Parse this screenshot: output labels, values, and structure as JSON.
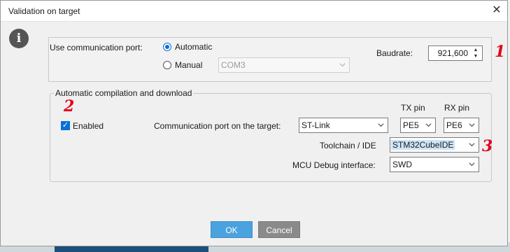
{
  "window": {
    "title": "Validation on target",
    "close": "✕"
  },
  "info_icon": {
    "glyph": "i",
    "name": "info-icon"
  },
  "comm_port": {
    "label": "Use communication port:",
    "automatic_label": "Automatic",
    "manual_label": "Manual",
    "selected": "Automatic",
    "port_value": "COM3",
    "baudrate_label": "Baudrate:",
    "baudrate_value": "921,600"
  },
  "compile_group": {
    "legend": "Automatic compilation and download",
    "enabled_label": "Enabled",
    "enabled_checked": true,
    "tx_header": "TX pin",
    "rx_header": "RX pin",
    "comm_port_label": "Communication port on the target:",
    "comm_port_value": "ST-Link",
    "tx_value": "PE5",
    "rx_value": "PE6",
    "toolchain_label": "Toolchain / IDE",
    "toolchain_value": "STM32CubeIDE",
    "mcu_debug_label": "MCU Debug interface:",
    "mcu_debug_value": "SWD"
  },
  "buttons": {
    "ok": "OK",
    "cancel": "Cancel"
  },
  "annotations": [
    "1",
    "2",
    "3"
  ],
  "colors": {
    "accent": "#0a6fd6",
    "ok": "#4aa3df",
    "cancel": "#8a8a8a",
    "annotation": "#e3001b"
  }
}
